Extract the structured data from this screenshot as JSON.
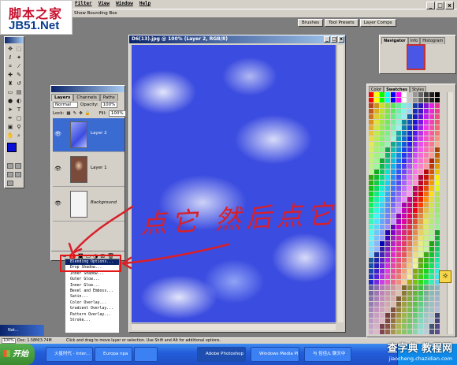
{
  "watermark_logo": {
    "line1": "脚本之家",
    "line2": "JB51.Net"
  },
  "menu": {
    "items": [
      "Filter",
      "View",
      "Window",
      "Help"
    ]
  },
  "options": {
    "bounding_box": "Show Bounding Box"
  },
  "top_palette_tabs": [
    "Brushes",
    "Tool Presets",
    "Layer Comps"
  ],
  "window_controls": {
    "minimize": "_",
    "restore": "□",
    "close": "x"
  },
  "toolbox": {
    "foreground_color": "#0b10d8",
    "background_color": "#ffffff"
  },
  "layers_panel": {
    "tabs": [
      "Layers",
      "Channels",
      "Paths"
    ],
    "blend_mode": "Normal",
    "opacity_label": "Opacity:",
    "opacity_value": "100%",
    "lock_label": "Lock:",
    "fill_label": "Fill:",
    "fill_value": "100%",
    "layers": [
      {
        "name": "Layer 2",
        "active": true
      },
      {
        "name": "Layer 1",
        "active": false
      },
      {
        "name": "Background",
        "active": false
      }
    ]
  },
  "context_menu": {
    "items": [
      "Blending Options...",
      "Drop Shadow...",
      "Inner Shadow...",
      "Outer Glow...",
      "Inner Glow...",
      "Bevel and Emboss...",
      "Satin...",
      "Color Overlay...",
      "Gradient Overlay...",
      "Pattern Overlay...",
      "Stroke..."
    ],
    "highlighted_index": 0
  },
  "document": {
    "title": "D6(13).jpg @ 100% (Layer 2, RGB/8)"
  },
  "annotation": {
    "text": "点它 然后点它",
    "color": "#d8202a"
  },
  "navigator": {
    "tabs": [
      "Navigator",
      "Info",
      "Histogram"
    ]
  },
  "swatches": {
    "tabs": [
      "Color",
      "Swatches",
      "Styles"
    ]
  },
  "status": {
    "zoom": "100%",
    "doc": "Doc: 1.58M/3.74M",
    "message": "Click and drag to move layer or selection. Use Shift and Alt for additional options."
  },
  "minimized_window": {
    "title": "Nat..."
  },
  "taskbar": {
    "start": "开始",
    "tasks": [
      "火星时代 - Inter...",
      "Europa npa",
      "",
      "Adobe Photoshop",
      "Windows Media Pl...",
      "与 佳佳/L 聊天中"
    ]
  },
  "watermark": {
    "main": "查字典 教程网",
    "sub": "jiaocheng.chazidian.com"
  }
}
